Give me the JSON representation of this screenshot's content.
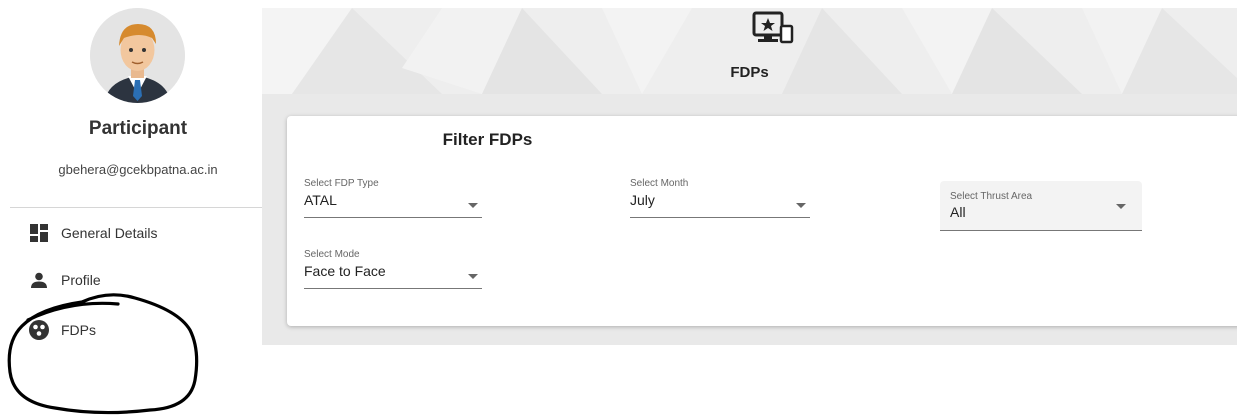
{
  "user": {
    "role": "Participant",
    "email": "gbehera@gcekbpatna.ac.in"
  },
  "nav": {
    "items": [
      {
        "label": "General Details",
        "icon": "dashboard-icon"
      },
      {
        "label": "Profile",
        "icon": "person-icon"
      },
      {
        "label": "FDPs",
        "icon": "group-work-icon"
      }
    ]
  },
  "header": {
    "title": "FDPs",
    "icon": "devices-star-icon"
  },
  "filter": {
    "title": "Filter FDPs",
    "fields": [
      {
        "label": "Select FDP Type",
        "value": "ATAL"
      },
      {
        "label": "Select Month",
        "value": "July"
      },
      {
        "label": "Select Thrust Area",
        "value": "All"
      },
      {
        "label": "Select Mode",
        "value": "Face to Face"
      }
    ]
  },
  "colors": {
    "card_bg": "#ffffff",
    "hero_bg": "#eeeeee",
    "text_primary": "#212121",
    "annotation_stroke": "#000000"
  }
}
